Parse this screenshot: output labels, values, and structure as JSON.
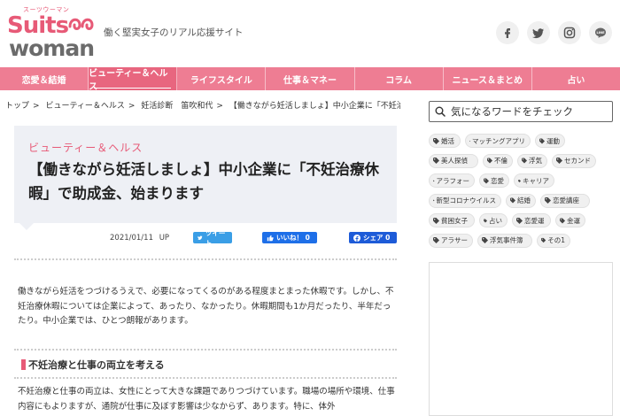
{
  "header": {
    "logo_top": "スーツウーマン",
    "logo_main": "Suits",
    "logo_sub": "woman",
    "tagline": "働く堅実女子のリアル応援サイト",
    "social": [
      {
        "name": "facebook-icon",
        "glyph": "f"
      },
      {
        "name": "twitter-icon",
        "glyph": ""
      },
      {
        "name": "instagram-icon",
        "glyph": ""
      },
      {
        "name": "line-icon",
        "glyph": "LINE"
      }
    ]
  },
  "nav": {
    "items": [
      {
        "label": "恋愛＆結婚"
      },
      {
        "label": "ビューティー＆ヘルス"
      },
      {
        "label": "ライフスタイル"
      },
      {
        "label": "仕事＆マネー"
      },
      {
        "label": "コラム"
      },
      {
        "label": "ニュース＆まとめ"
      },
      {
        "label": "占い"
      }
    ],
    "active_index": 1
  },
  "breadcrumb": {
    "items": [
      "トップ",
      "ビューティー＆ヘルス",
      "妊活診断　笛吹和代",
      "【働きながら妊活しましょ】中小企業に「不妊治療休暇..."
    ],
    "separator": ">"
  },
  "article": {
    "category": "ビューティー＆ヘルス",
    "title": "【働きながら妊活しましょ】中小企業に「不妊治療休暇」で助成金、始まります",
    "date": "2021/01/11",
    "date_suffix": "UP",
    "share": {
      "tweet": "ツイート",
      "like": "いいね！ 0",
      "fb_share": "シェア 0"
    },
    "intro": "働きながら妊活をつづけるうえで、必要になってくるのがある程度まとまった休暇です。しかし、不妊治療休暇については企業によって、あったり、なかったり。休暇期間も1か月だったり、半年だったり。中小企業では、ひとつ朗報があります。",
    "section_heading": "不妊治療と仕事の両立を考える",
    "section_text": "不妊治療と仕事の両立は、女性にとって大きな課題でありつづけています。職場の場所や環境、仕事内容にもよりますが、通院が仕事に及ぼす影響は少なからず、あります。特に、体外"
  },
  "sidebar": {
    "search_placeholder": "気になるワードをチェック",
    "tags": [
      "婚活",
      "マッチングアプリ",
      "運動",
      "美人探偵",
      "不倫",
      "浮気",
      "セカンド",
      "アラフォー",
      "恋愛",
      "キャリア",
      "新型コロナウイルス",
      "結婚",
      "恋愛講座",
      "貧困女子",
      "占い",
      "恋愛運",
      "金運",
      "アラサー",
      "浮気事件簿",
      "その1"
    ]
  },
  "colors": {
    "brand_pink": "#ee7d93",
    "accent_pink": "#e75a77",
    "twitter_blue": "#3a9ee6",
    "fb_blue": "#1d5bd8"
  }
}
